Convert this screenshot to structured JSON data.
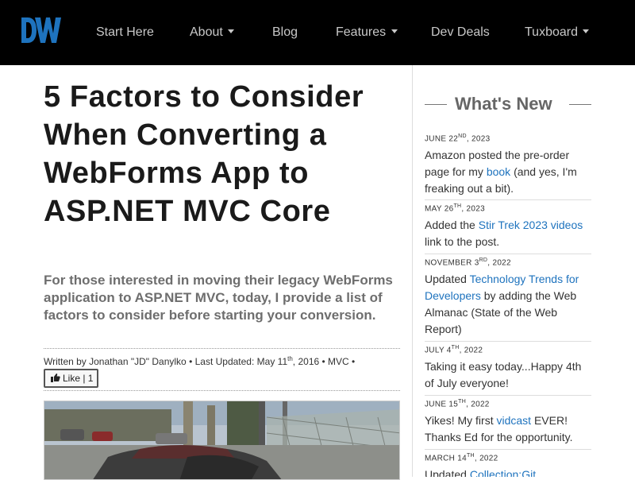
{
  "nav": {
    "logo_text": "DW",
    "items": [
      {
        "label": "Start Here",
        "dropdown": false
      },
      {
        "label": "About",
        "dropdown": true
      },
      {
        "label": "Blog",
        "dropdown": false
      },
      {
        "label": "Features",
        "dropdown": true
      },
      {
        "label": "Dev Deals",
        "dropdown": false
      },
      {
        "label": "Tuxboard",
        "dropdown": true
      }
    ]
  },
  "article": {
    "title": "5 Factors to Consider When Converting a WebForms App to ASP.NET MVC Core",
    "subtitle": "For those interested in moving their legacy WebForms application to ASP.NET MVC, today, I provide a list of factors to consider before starting your conversion.",
    "meta": {
      "written_by": "Written by Jonathan \"JD\" Danylko",
      "updated_prefix": "• Last Updated: May 11",
      "updated_suffix": "th",
      "updated_year": ", 2016",
      "category": "• MVC •"
    },
    "like_label": "Like | 1"
  },
  "sidebar": {
    "title": "What's New",
    "items": [
      {
        "date_pre": "June 22",
        "date_sup": "nd",
        "date_post": ", 2023",
        "parts": [
          "Amazon posted the pre-order page for my ",
          "book",
          " (and yes, I'm freaking out a bit)."
        ]
      },
      {
        "date_pre": "May 26",
        "date_sup": "th",
        "date_post": ", 2023",
        "parts": [
          "Added the ",
          "Stir Trek 2023 videos",
          " link to the post."
        ]
      },
      {
        "date_pre": "November 3",
        "date_sup": "rd",
        "date_post": ", 2022",
        "parts": [
          "Updated ",
          "Technology Trends for Developers",
          " by adding the Web Almanac (State of the Web Report)"
        ]
      },
      {
        "date_pre": "July 4",
        "date_sup": "th",
        "date_post": ", 2022",
        "parts": [
          "Taking it easy today...Happy 4th of July everyone!",
          "",
          ""
        ]
      },
      {
        "date_pre": "June 15",
        "date_sup": "th",
        "date_post": ", 2022",
        "parts": [
          "Yikes! My first ",
          "vidcast",
          " EVER! Thanks Ed for the opportunity."
        ]
      },
      {
        "date_pre": "March 14",
        "date_sup": "th",
        "date_post": ", 2022",
        "parts": [
          "Updated ",
          "Collection:Git Resources",
          ""
        ]
      }
    ]
  },
  "colors": {
    "navbar_bg": "#000000",
    "logo_blue": "#1e73be",
    "link": "#1e73be"
  },
  "icons": [
    "dw-logo",
    "caret-down-icon",
    "thumbs-up-icon"
  ]
}
